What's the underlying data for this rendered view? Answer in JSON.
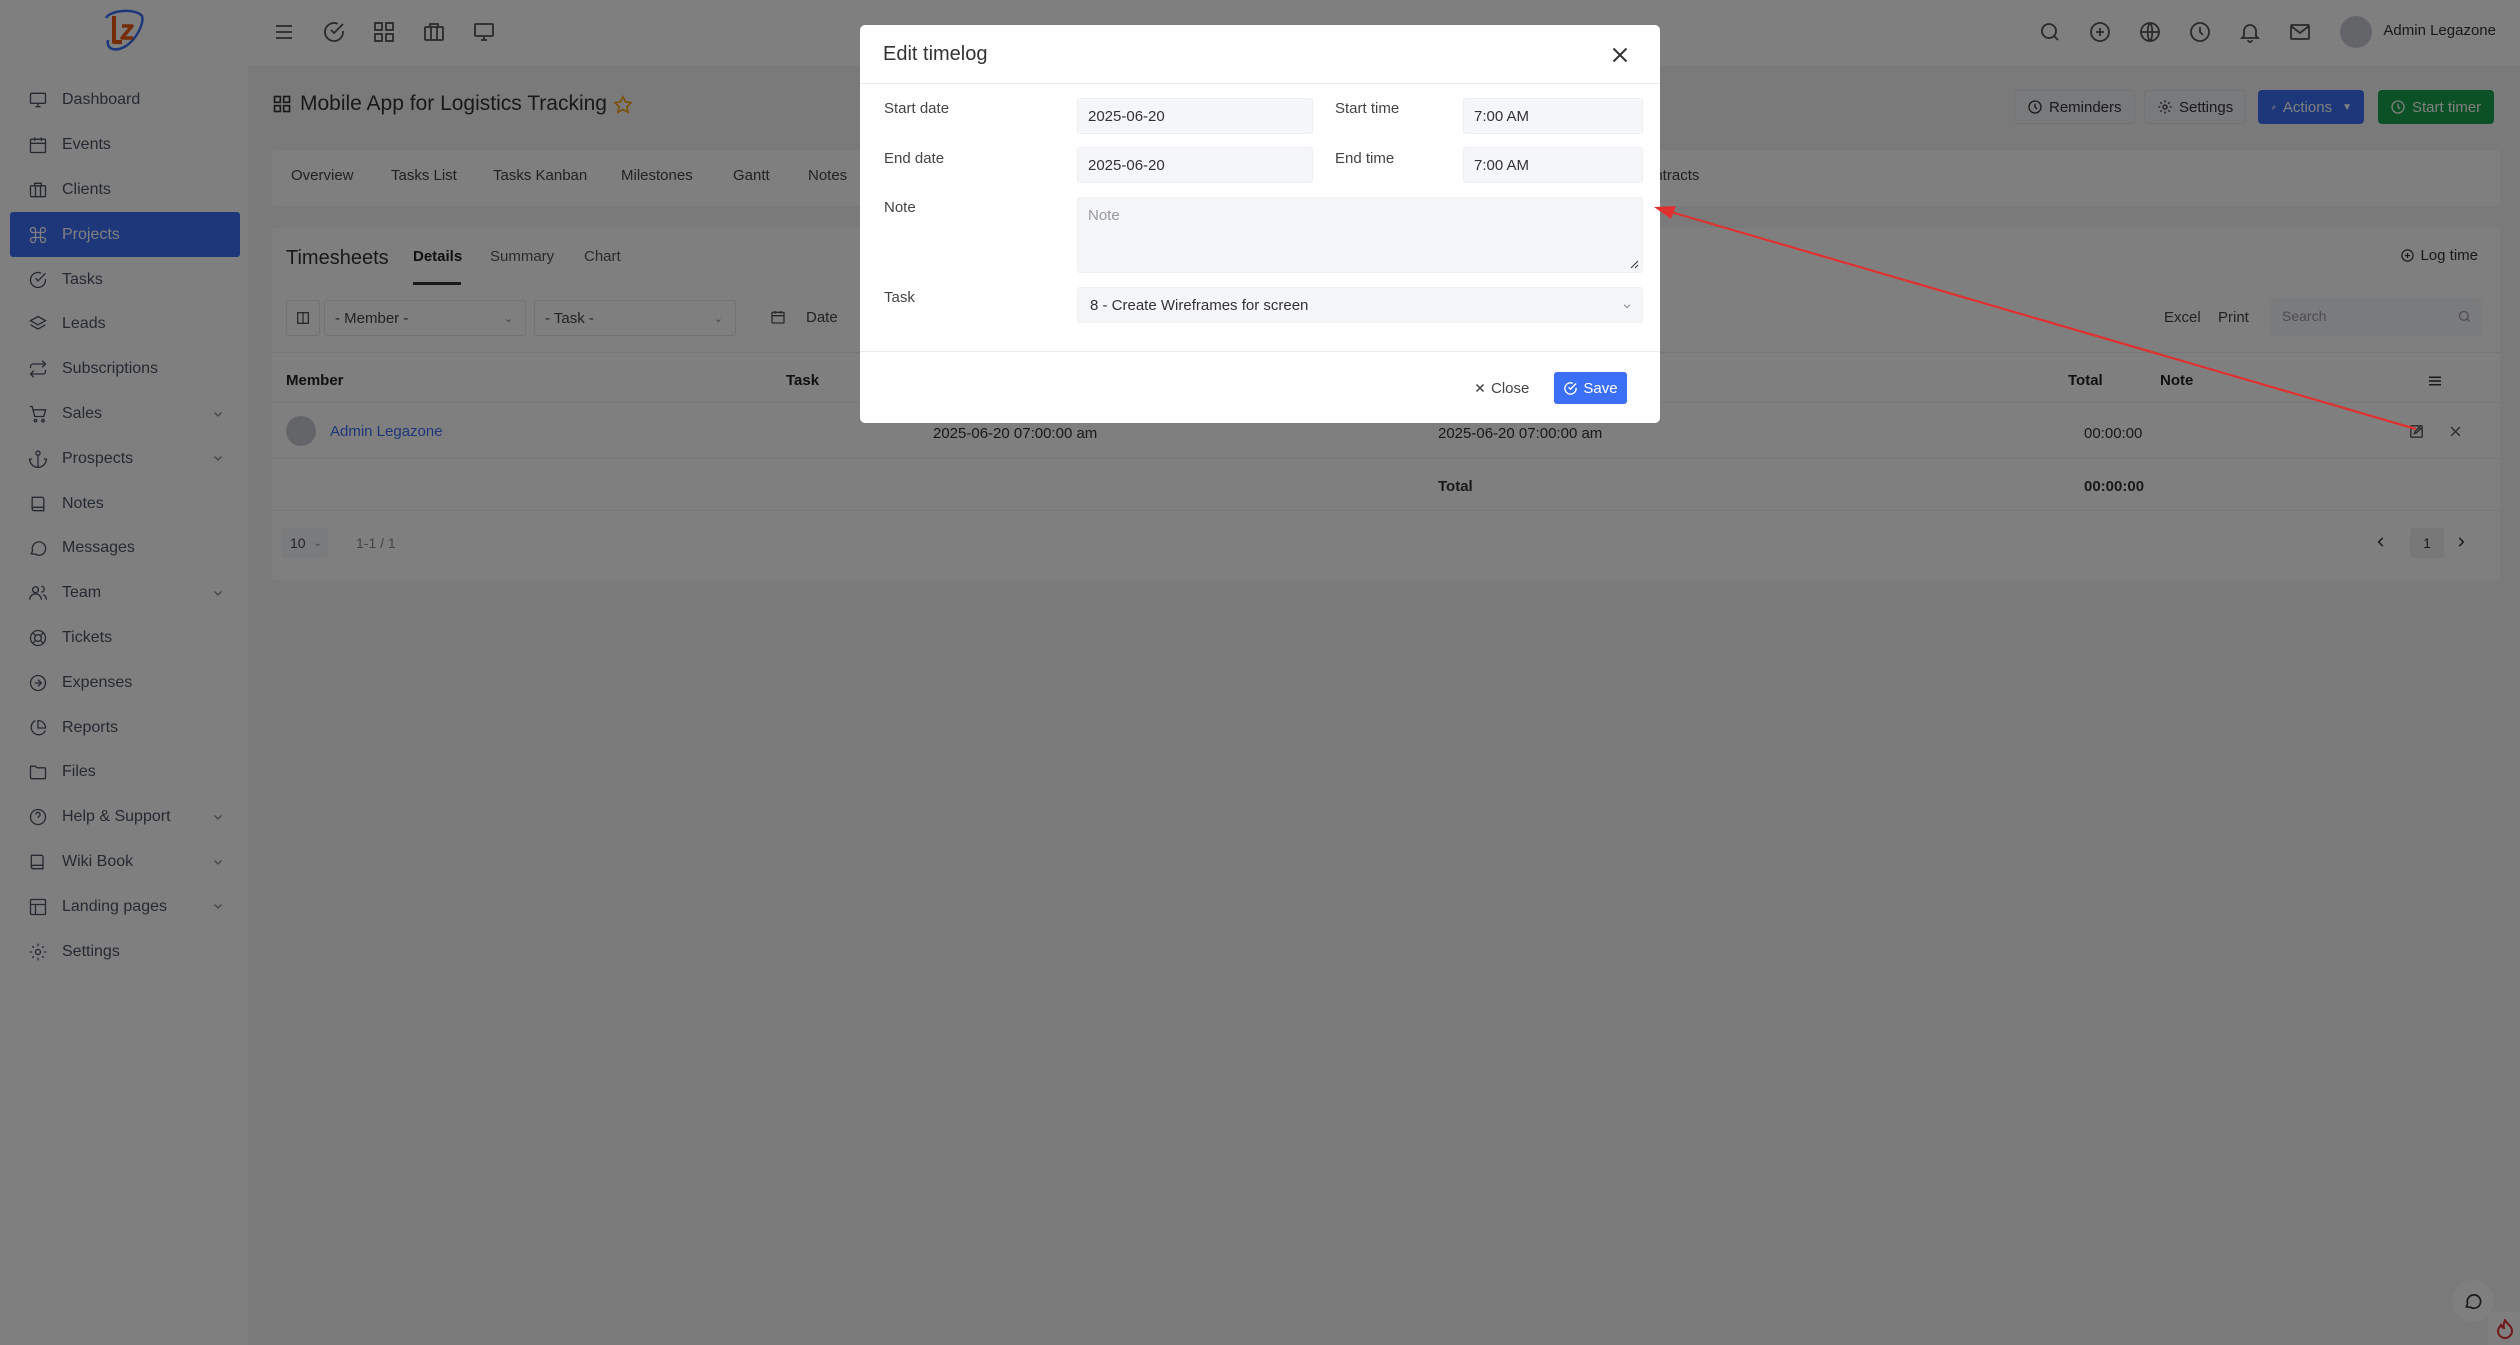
{
  "topbar": {
    "user_name": "Admin Legazone"
  },
  "sidebar": {
    "items": [
      {
        "label": "Dashboard",
        "icon": "monitor-icon",
        "expandable": false,
        "active": false
      },
      {
        "label": "Events",
        "icon": "calendar-icon",
        "expandable": false,
        "active": false
      },
      {
        "label": "Clients",
        "icon": "briefcase-icon",
        "expandable": false,
        "active": false
      },
      {
        "label": "Projects",
        "icon": "command-icon",
        "expandable": false,
        "active": true
      },
      {
        "label": "Tasks",
        "icon": "check-circle-icon",
        "expandable": false,
        "active": false
      },
      {
        "label": "Leads",
        "icon": "layers-icon",
        "expandable": false,
        "active": false
      },
      {
        "label": "Subscriptions",
        "icon": "repeat-icon",
        "expandable": false,
        "active": false
      },
      {
        "label": "Sales",
        "icon": "cart-icon",
        "expandable": true,
        "active": false
      },
      {
        "label": "Prospects",
        "icon": "anchor-icon",
        "expandable": true,
        "active": false
      },
      {
        "label": "Notes",
        "icon": "book-icon",
        "expandable": false,
        "active": false
      },
      {
        "label": "Messages",
        "icon": "message-icon",
        "expandable": false,
        "active": false
      },
      {
        "label": "Team",
        "icon": "users-icon",
        "expandable": true,
        "active": false
      },
      {
        "label": "Tickets",
        "icon": "life-buoy-icon",
        "expandable": false,
        "active": false
      },
      {
        "label": "Expenses",
        "icon": "arrow-circle-icon",
        "expandable": false,
        "active": false
      },
      {
        "label": "Reports",
        "icon": "pie-chart-icon",
        "expandable": false,
        "active": false
      },
      {
        "label": "Files",
        "icon": "folder-icon",
        "expandable": false,
        "active": false
      },
      {
        "label": "Help & Support",
        "icon": "help-circle-icon",
        "expandable": true,
        "active": false
      },
      {
        "label": "Wiki Book",
        "icon": "book-open-icon",
        "expandable": true,
        "active": false
      },
      {
        "label": "Landing pages",
        "icon": "layout-icon",
        "expandable": true,
        "active": false
      },
      {
        "label": "Settings",
        "icon": "gear-icon",
        "expandable": false,
        "active": false
      }
    ]
  },
  "project": {
    "title": "Mobile App for Logistics Tracking",
    "reminders_label": "Reminders",
    "settings_label": "Settings",
    "actions_label": "Actions",
    "start_timer_label": "Start timer"
  },
  "tabs": [
    "Overview",
    "Tasks List",
    "Tasks Kanban",
    "Milestones",
    "Gantt",
    "Notes",
    "ontracts"
  ],
  "timesheets": {
    "title": "Timesheets",
    "tabs": [
      "Details",
      "Summary",
      "Chart"
    ],
    "log_time_label": "Log time",
    "filters": {
      "member": "- Member -",
      "task": "- Task -",
      "date": "Date"
    },
    "export": {
      "excel": "Excel",
      "print": "Print"
    },
    "search_placeholder": "Search",
    "columns": {
      "member": "Member",
      "task": "Task",
      "total": "Total",
      "note": "Note"
    },
    "row": {
      "member": "Admin Legazone",
      "start": "2025-06-20 07:00:00 am",
      "end": "2025-06-20 07:00:00 am",
      "total": "00:00:00"
    },
    "footer": {
      "total_label": "Total",
      "total_value": "00:00:00"
    },
    "page_size": "10",
    "range": "1-1 / 1",
    "page": "1"
  },
  "modal": {
    "title": "Edit timelog",
    "start_date_label": "Start date",
    "start_date": "2025-06-20",
    "start_time_label": "Start time",
    "start_time": "7:00 AM",
    "end_date_label": "End date",
    "end_date": "2025-06-20",
    "end_time_label": "End time",
    "end_time": "7:00 AM",
    "note_label": "Note",
    "note_placeholder": "Note",
    "task_label": "Task",
    "task_value": "8 - Create Wireframes for screen",
    "close_label": "Close",
    "save_label": "Save"
  },
  "colors": {
    "primary": "#3b6ff5",
    "success": "#16a34a",
    "annotation": "#e03131"
  }
}
